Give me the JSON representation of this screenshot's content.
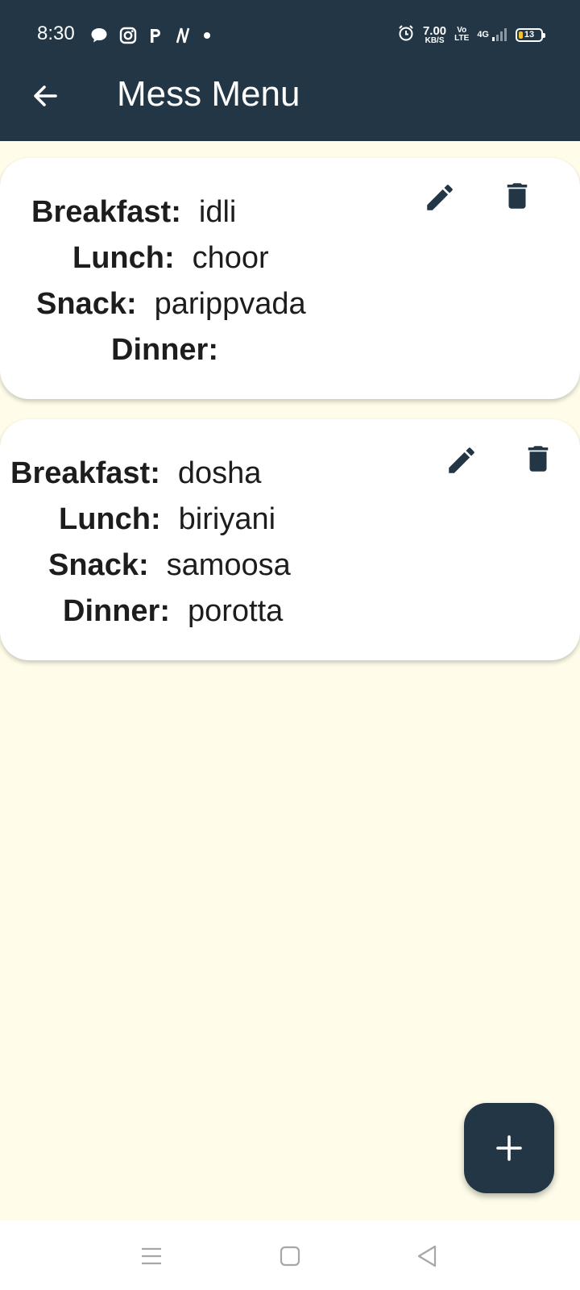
{
  "status_bar": {
    "time": "8:30",
    "speed_value": "7.00",
    "speed_unit": "KB/S",
    "volte_top": "Vo",
    "volte_bottom": "LTE",
    "network": "4G",
    "battery_level": "13",
    "icons": [
      "chat-bubble-icon",
      "instagram-icon",
      "p-app-icon",
      "n-app-icon",
      "notification-dot-icon",
      "alarm-icon",
      "signal-icon",
      "battery-icon"
    ]
  },
  "app_bar": {
    "title": "Mess Menu",
    "back_icon": "arrow-left-icon"
  },
  "colors": {
    "primary": "#223645",
    "background": "#fffde9",
    "card": "#ffffff",
    "text": "#1d1d1d",
    "battery": "#f3c12b"
  },
  "menus": [
    {
      "breakfast_label": "Breakfast:",
      "breakfast": "idli",
      "lunch_label": "Lunch:",
      "lunch": "choor",
      "snack_label": "Snack:",
      "snack": "parippvada",
      "dinner_label": "Dinner:",
      "dinner": ""
    },
    {
      "breakfast_label": "Breakfast:",
      "breakfast": "dosha",
      "lunch_label": "Lunch:",
      "lunch": "biriyani",
      "snack_label": "Snack:",
      "snack": "samoosa",
      "dinner_label": "Dinner:",
      "dinner": "porotta"
    }
  ],
  "fab": {
    "icon": "plus-icon"
  },
  "nav_bar": {
    "icons": [
      "menu-icon",
      "home-square-icon",
      "back-triangle-icon"
    ]
  }
}
